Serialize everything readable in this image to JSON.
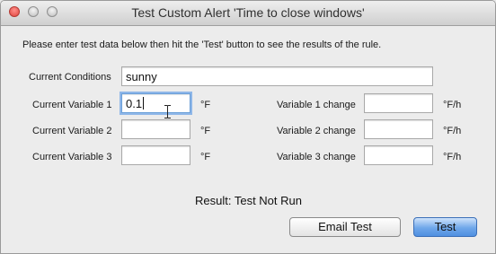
{
  "window": {
    "title": "Test Custom Alert 'Time to close windows'"
  },
  "instructions": "Please enter test data below then hit the 'Test' button to see the results of the rule.",
  "conditions": {
    "label": "Current Conditions",
    "value": "sunny"
  },
  "variables": [
    {
      "label": "Current Variable 1",
      "value": "0.1",
      "unit": "°F",
      "change_label": "Variable 1 change",
      "change_value": "",
      "change_unit": "°F/h"
    },
    {
      "label": "Current Variable 2",
      "value": "",
      "unit": "°F",
      "change_label": "Variable 2 change",
      "change_value": "",
      "change_unit": "°F/h"
    },
    {
      "label": "Current Variable 3",
      "value": "",
      "unit": "°F",
      "change_label": "Variable 3 change",
      "change_value": "",
      "change_unit": "°F/h"
    }
  ],
  "result": "Result: Test Not Run",
  "buttons": {
    "email": "Email Test",
    "test": "Test"
  }
}
